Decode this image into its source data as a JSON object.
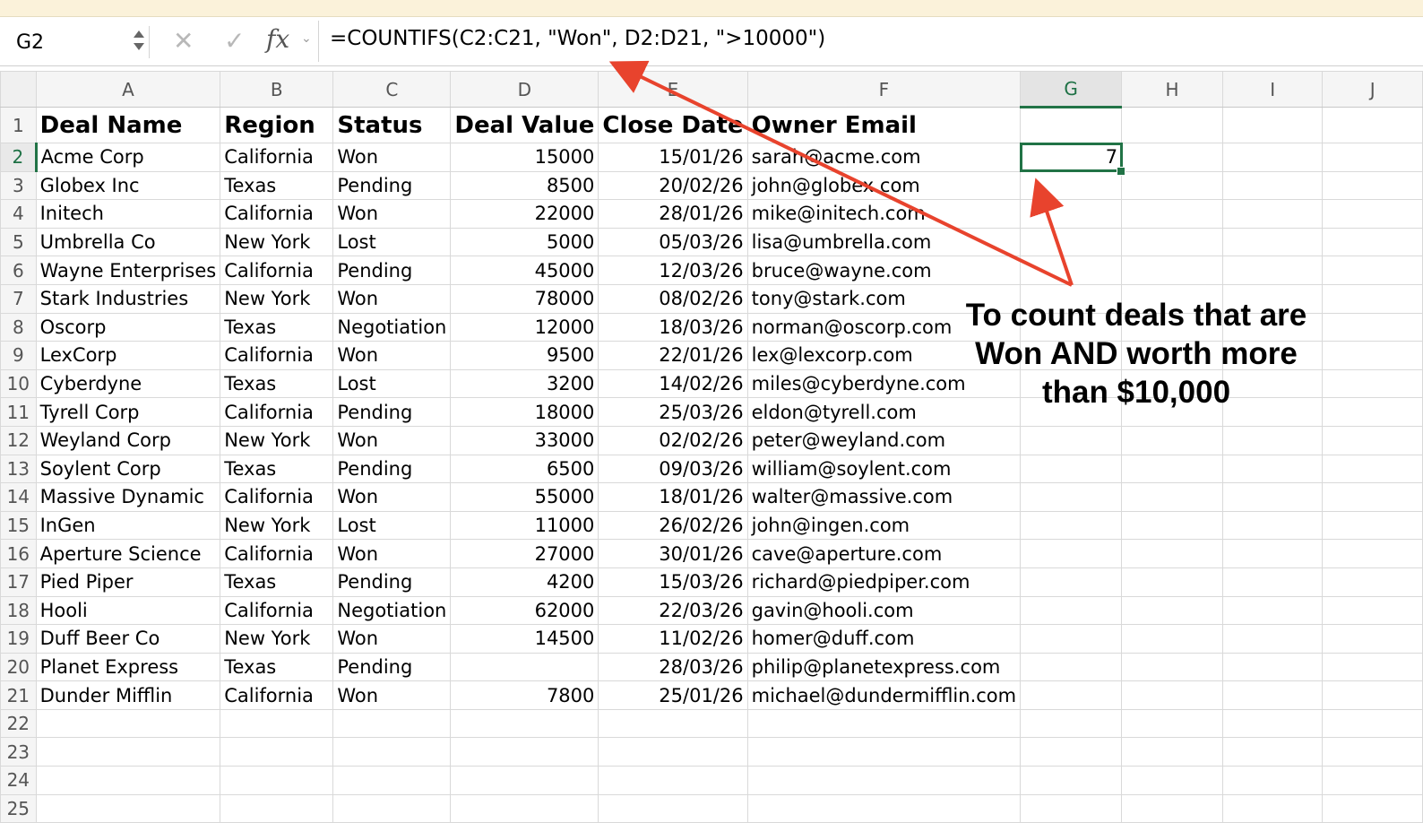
{
  "formula_bar": {
    "cell_ref": "G2",
    "cancel_icon": "✕",
    "enter_icon": "✓",
    "fx_label": "fx",
    "formula": "=COUNTIFS(C2:C21, \"Won\", D2:D21, \">10000\")"
  },
  "columns": [
    "A",
    "B",
    "C",
    "D",
    "E",
    "F",
    "G",
    "H",
    "I",
    "J"
  ],
  "selected_cell": "G2",
  "header_row": {
    "deal_name": "Deal Name",
    "region": "Region",
    "status": "Status",
    "deal_value": "Deal Value",
    "close_date": "Close Date",
    "owner_email": "Owner Email"
  },
  "rows": [
    {
      "num": "2",
      "name": "Acme Corp",
      "region": "California",
      "status": "Won",
      "value": "15000",
      "date": "15/01/26",
      "email": "sarah@acme.com",
      "g": "7"
    },
    {
      "num": "3",
      "name": "Globex Inc",
      "region": "Texas",
      "status": "Pending",
      "value": "8500",
      "date": "20/02/26",
      "email": "john@globex.com",
      "g": ""
    },
    {
      "num": "4",
      "name": "Initech",
      "region": "California",
      "status": "Won",
      "value": "22000",
      "date": "28/01/26",
      "email": "mike@initech.com",
      "g": ""
    },
    {
      "num": "5",
      "name": "Umbrella Co",
      "region": "New York",
      "status": "Lost",
      "value": "5000",
      "date": "05/03/26",
      "email": "lisa@umbrella.com",
      "g": ""
    },
    {
      "num": "6",
      "name": "Wayne Enterprises",
      "region": "California",
      "status": "Pending",
      "value": "45000",
      "date": "12/03/26",
      "email": "bruce@wayne.com",
      "g": ""
    },
    {
      "num": "7",
      "name": "Stark Industries",
      "region": "New York",
      "status": "Won",
      "value": "78000",
      "date": "08/02/26",
      "email": "tony@stark.com",
      "g": ""
    },
    {
      "num": "8",
      "name": "Oscorp",
      "region": "Texas",
      "status": "Negotiation",
      "value": "12000",
      "date": "18/03/26",
      "email": "norman@oscorp.com",
      "g": ""
    },
    {
      "num": "9",
      "name": "LexCorp",
      "region": "California",
      "status": "Won",
      "value": "9500",
      "date": "22/01/26",
      "email": "lex@lexcorp.com",
      "g": ""
    },
    {
      "num": "10",
      "name": "Cyberdyne",
      "region": "Texas",
      "status": "Lost",
      "value": "3200",
      "date": "14/02/26",
      "email": "miles@cyberdyne.com",
      "g": ""
    },
    {
      "num": "11",
      "name": "Tyrell Corp",
      "region": "California",
      "status": "Pending",
      "value": "18000",
      "date": "25/03/26",
      "email": "eldon@tyrell.com",
      "g": ""
    },
    {
      "num": "12",
      "name": "Weyland Corp",
      "region": "New York",
      "status": "Won",
      "value": "33000",
      "date": "02/02/26",
      "email": "peter@weyland.com",
      "g": ""
    },
    {
      "num": "13",
      "name": "Soylent Corp",
      "region": "Texas",
      "status": "Pending",
      "value": "6500",
      "date": "09/03/26",
      "email": "william@soylent.com",
      "g": ""
    },
    {
      "num": "14",
      "name": "Massive Dynamic",
      "region": "California",
      "status": "Won",
      "value": "55000",
      "date": "18/01/26",
      "email": "walter@massive.com",
      "g": ""
    },
    {
      "num": "15",
      "name": "InGen",
      "region": "New York",
      "status": "Lost",
      "value": "11000",
      "date": "26/02/26",
      "email": "john@ingen.com",
      "g": ""
    },
    {
      "num": "16",
      "name": "Aperture Science",
      "region": "California",
      "status": "Won",
      "value": "27000",
      "date": "30/01/26",
      "email": "cave@aperture.com",
      "g": ""
    },
    {
      "num": "17",
      "name": "Pied Piper",
      "region": "Texas",
      "status": "Pending",
      "value": "4200",
      "date": "15/03/26",
      "email": "richard@piedpiper.com",
      "g": ""
    },
    {
      "num": "18",
      "name": "Hooli",
      "region": "California",
      "status": "Negotiation",
      "value": "62000",
      "date": "22/03/26",
      "email": "gavin@hooli.com",
      "g": ""
    },
    {
      "num": "19",
      "name": "Duff Beer Co",
      "region": "New York",
      "status": "Won",
      "value": "14500",
      "date": "11/02/26",
      "email": "homer@duff.com",
      "g": ""
    },
    {
      "num": "20",
      "name": "Planet Express",
      "region": "Texas",
      "status": "Pending",
      "value": "",
      "date": "28/03/26",
      "email": "philip@planetexpress.com",
      "g": ""
    },
    {
      "num": "21",
      "name": "Dunder Mifflin",
      "region": "California",
      "status": "Won",
      "value": "7800",
      "date": "25/01/26",
      "email": "michael@dundermifflin.com",
      "g": ""
    }
  ],
  "empty_rows": [
    "22",
    "23",
    "24",
    "25"
  ],
  "annotation": {
    "line1": "To count deals that are",
    "line2": "Won AND worth more",
    "line3": "than $10,000",
    "arrow_color": "#e8432d"
  },
  "colors": {
    "selection": "#217346",
    "top_strip": "#fbf2da"
  }
}
